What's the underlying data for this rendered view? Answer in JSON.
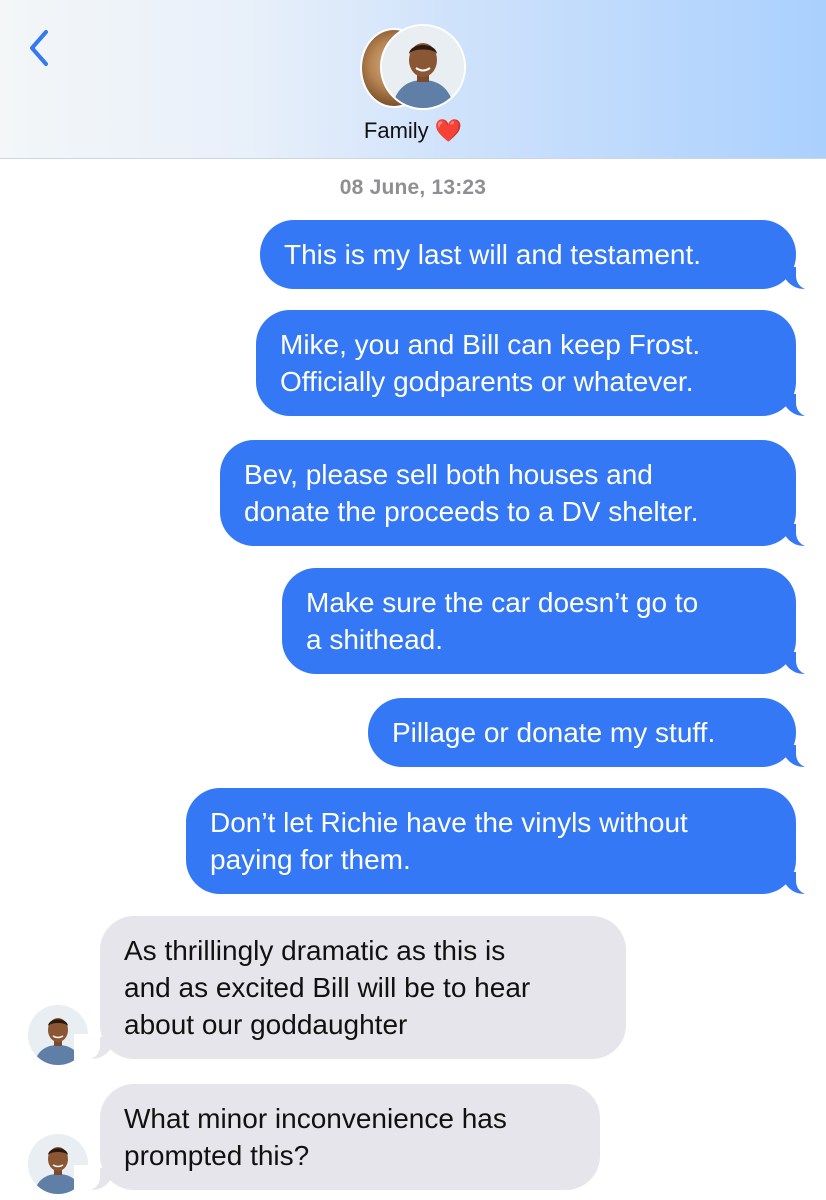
{
  "header": {
    "back_icon": "chevron-left-icon",
    "group_name": "Family",
    "heart_emoji": "❤️",
    "accent": "#3478f6"
  },
  "timestamp": "08 June, 13:23",
  "messages_out": [
    {
      "lines": [
        "This is my last will and testament."
      ]
    },
    {
      "lines": [
        "Mike, you and Bill can keep Frost.",
        "Officially godparents or whatever."
      ]
    },
    {
      "lines": [
        "Bev, please sell both houses and",
        "donate the proceeds to a DV shelter."
      ]
    },
    {
      "lines": [
        "Make sure the car doesn’t go to",
        "a shithead."
      ]
    },
    {
      "lines": [
        "Pillage or donate my stuff."
      ]
    },
    {
      "lines": [
        "Don’t let Richie have the vinyls without",
        "paying for them."
      ]
    }
  ],
  "messages_in": [
    {
      "lines": [
        "As thrillingly dramatic as this is",
        "and as excited Bill will be to hear",
        "about our goddaughter"
      ]
    },
    {
      "lines": [
        "What minor inconvenience has",
        "prompted this?"
      ]
    }
  ],
  "colors": {
    "outgoing_bubble": "#3478f6",
    "incoming_bubble": "#e6e5eb",
    "timestamp_text": "#8e8e93"
  }
}
